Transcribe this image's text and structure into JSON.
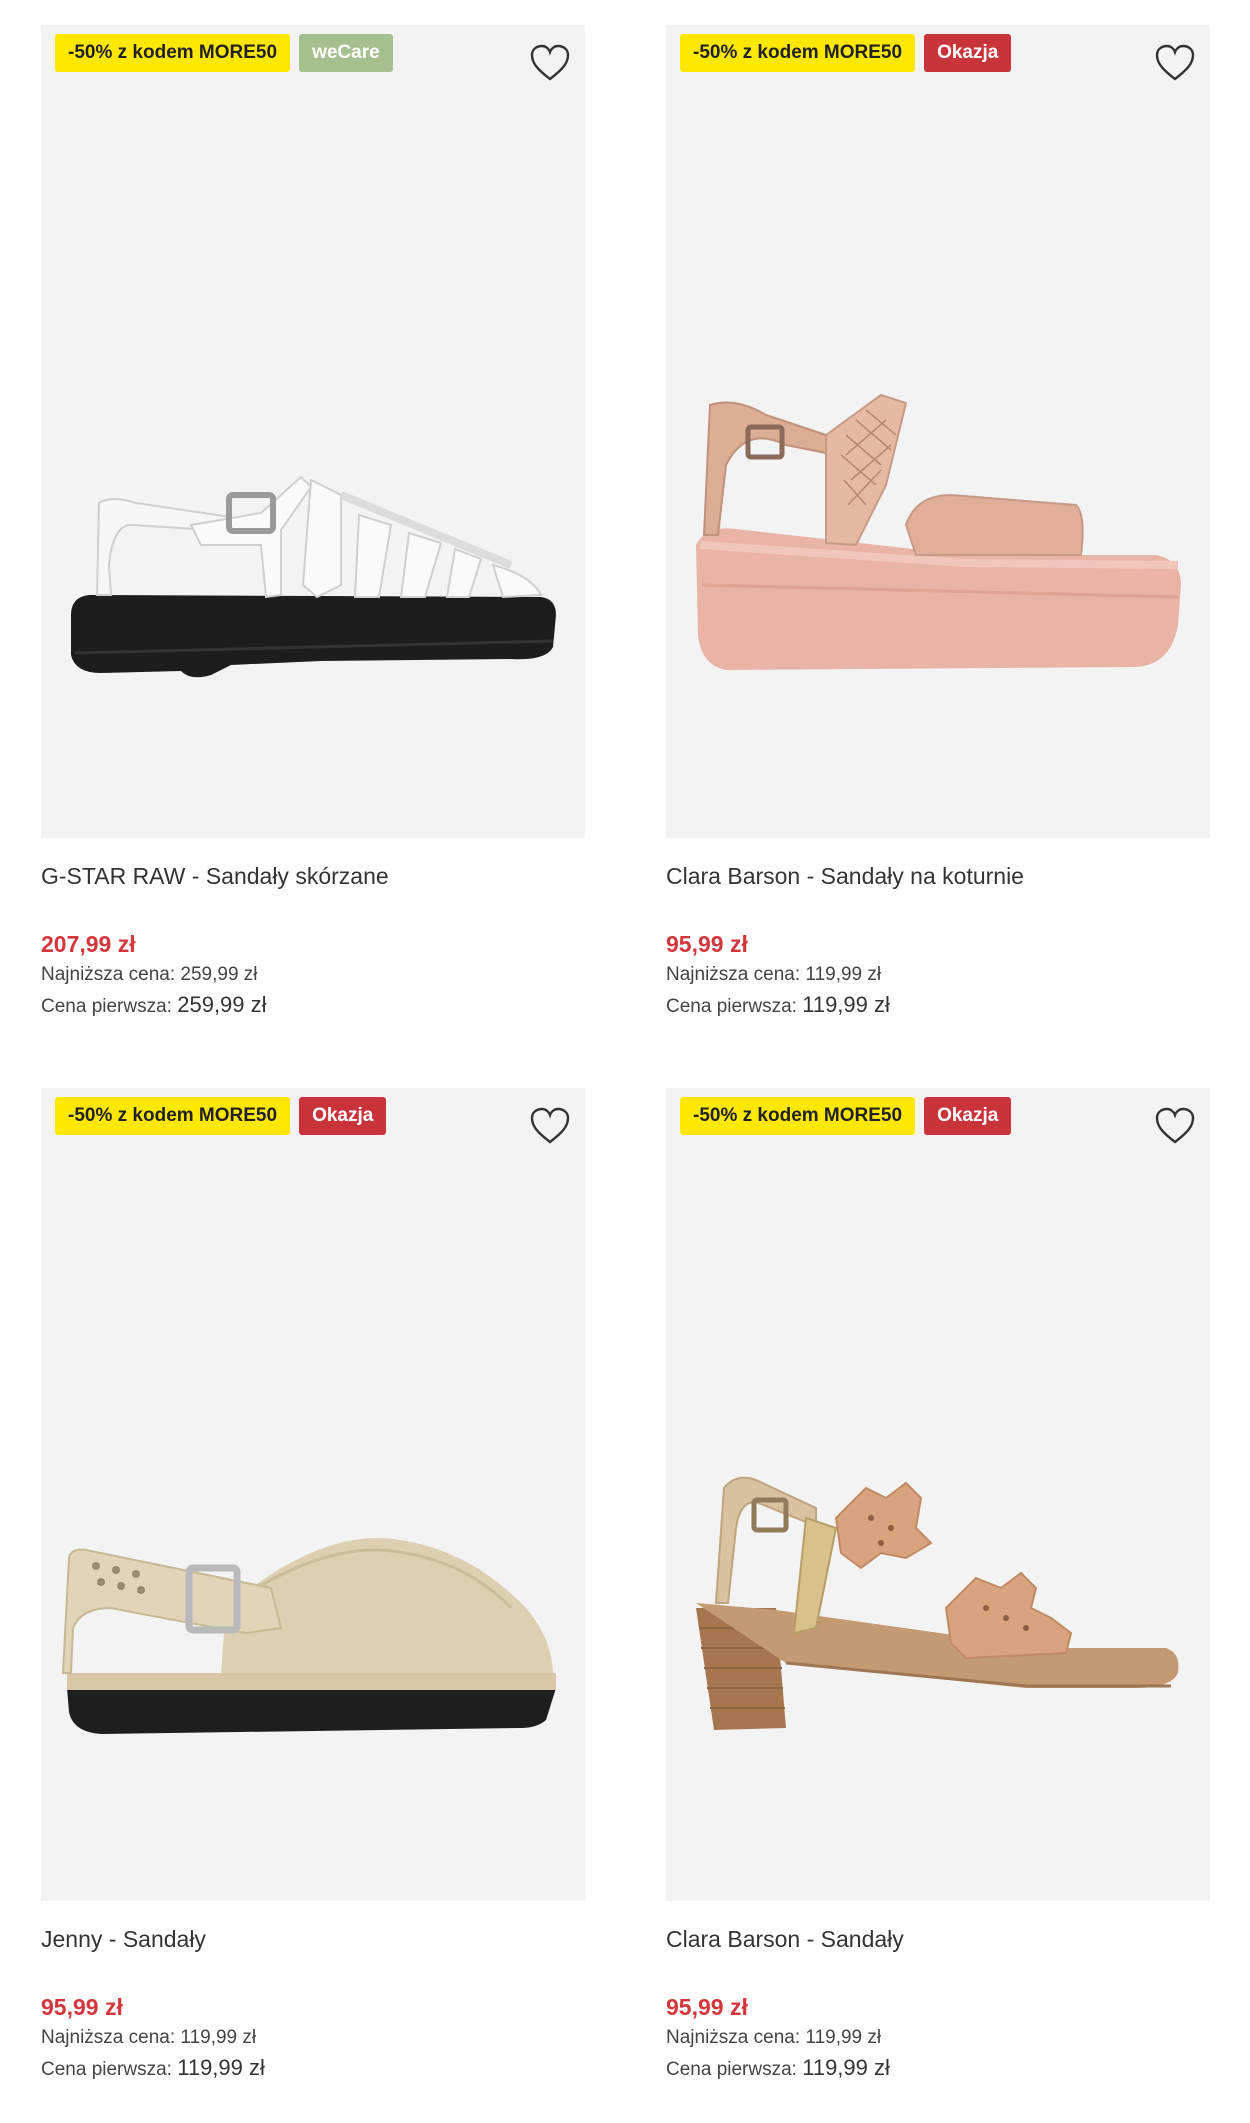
{
  "products": [
    {
      "promo_badge": "-50% z kodem MORE50",
      "tag_badge": "weCare",
      "tag_type": "wecare",
      "title": "G-STAR RAW - Sandały skórzane",
      "price": "207,99 zł",
      "lowest_label": "Najniższa cena:",
      "lowest_value": "259,99 zł",
      "original_label": "Cena pierwsza:",
      "original_value": "259,99 zł",
      "shoe_icon": "white-fisherman-sandal-image"
    },
    {
      "promo_badge": "-50% z kodem MORE50",
      "tag_badge": "Okazja",
      "tag_type": "okazja",
      "title": "Clara Barson - Sandały na koturnie",
      "price": "95,99 zł",
      "lowest_label": "Najniższa cena:",
      "lowest_value": "119,99 zł",
      "original_label": "Cena pierwsza:",
      "original_value": "119,99 zł",
      "shoe_icon": "pink-wedge-sandal-image"
    },
    {
      "promo_badge": "-50% z kodem MORE50",
      "tag_badge": "Okazja",
      "tag_type": "okazja",
      "title": "Jenny - Sandały",
      "price": "95,99 zł",
      "lowest_label": "Najniższa cena:",
      "lowest_value": "119,99 zł",
      "original_label": "Cena pierwsza:",
      "original_value": "119,99 zł",
      "shoe_icon": "beige-clog-image"
    },
    {
      "promo_badge": "-50% z kodem MORE50",
      "tag_badge": "Okazja",
      "tag_type": "okazja",
      "title": "Clara Barson - Sandały",
      "price": "95,99 zł",
      "lowest_label": "Najniższa cena:",
      "lowest_value": "119,99 zł",
      "original_label": "Cena pierwsza:",
      "original_value": "119,99 zł",
      "shoe_icon": "tan-heeled-sandal-image"
    }
  ],
  "colors": {
    "promo_badge_bg": "#fee800",
    "wecare_badge_bg": "#a6bf8e",
    "okazja_badge_bg": "#c9343a",
    "price_red": "#d3373d",
    "image_bg": "#f3f3f3"
  },
  "icons": {
    "favorite": "heart-outline-icon"
  }
}
